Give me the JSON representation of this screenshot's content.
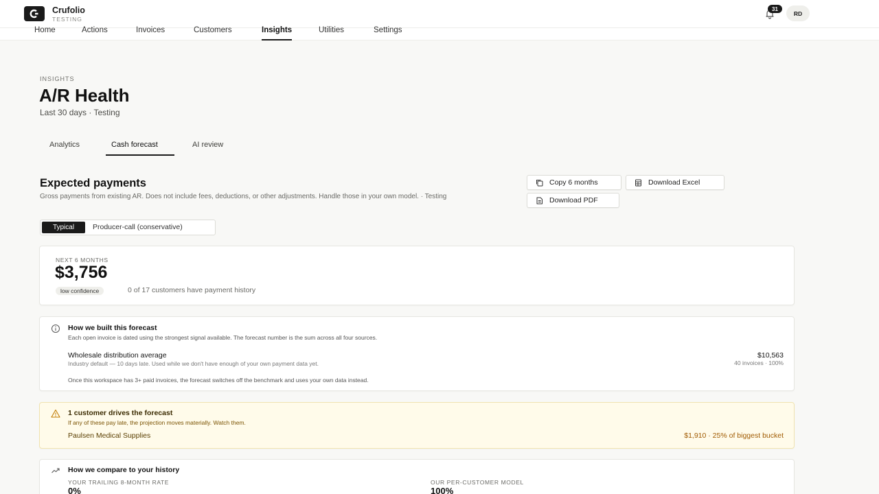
{
  "brand": {
    "name": "Crufolio",
    "workspace": "TESTING"
  },
  "header": {
    "notifications_count": "31",
    "avatar_initials": "RD"
  },
  "nav": [
    "Home",
    "Actions",
    "Invoices",
    "Customers",
    "Insights",
    "Utilities",
    "Settings"
  ],
  "page": {
    "eyebrow": "INSIGHTS",
    "title": "A/R Health",
    "subtitle": "Last 30 days · Testing"
  },
  "tabs": [
    "Analytics",
    "Cash forecast",
    "AI review"
  ],
  "section": {
    "title": "Expected payments",
    "description": "Gross payments from existing AR. Does not include fees, deductions, or other adjustments. Handle those in your own model. · Testing"
  },
  "actions": {
    "copy": "Copy 6 months",
    "excel": "Download Excel",
    "pdf": "Download PDF"
  },
  "mode": {
    "typical": "Typical",
    "conservative": "Producer-call (conservative)"
  },
  "kpi": {
    "label": "NEXT 6 MONTHS",
    "value": "$3,756",
    "confidence": "low confidence",
    "note": "0 of 17 customers have payment history"
  },
  "built": {
    "title": "How we built this forecast",
    "desc": "Each open invoice is dated using the strongest signal available. The forecast number is the sum across all four sources.",
    "row_name": "Wholesale distribution average",
    "row_sub": "Industry default — 10 days late. Used while we don't have enough of your own payment data yet.",
    "row_amount": "$10,563",
    "row_meta": "40 invoices · 100%",
    "footer": "Once this workspace has 3+ paid invoices, the forecast switches off the benchmark and uses your own data instead."
  },
  "concentration": {
    "title": "1 customer drives the forecast",
    "desc": "If any of these pay late, the projection moves materially. Watch them.",
    "customer": "Paulsen Medical Supplies",
    "amount": "$1,910 · 25% of biggest bucket"
  },
  "compare": {
    "title": "How we compare to your history",
    "left_label": "YOUR TRAILING 8-MONTH RATE",
    "left_value": "0%",
    "right_label": "OUR PER-CUSTOMER MODEL",
    "right_value": "100%"
  },
  "colors": {
    "accent": "#1a1a1a",
    "warning_bg": "#fffbea",
    "warning_text": "#a05a00"
  }
}
